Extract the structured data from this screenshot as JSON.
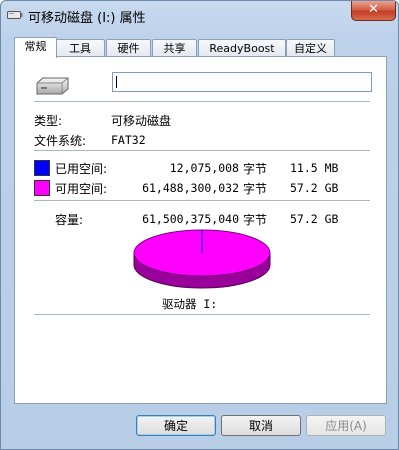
{
  "window": {
    "title": "可移动磁盘 (I:) 属性",
    "close_glyph": "✕"
  },
  "tabs": [
    {
      "label": "常规",
      "active": true
    },
    {
      "label": "工具",
      "active": false
    },
    {
      "label": "硬件",
      "active": false
    },
    {
      "label": "共享",
      "active": false
    },
    {
      "label": "ReadyBoost",
      "active": false
    },
    {
      "label": "自定义",
      "active": false
    }
  ],
  "general": {
    "volume_label_value": "",
    "type_label": "类型:",
    "type_value": "可移动磁盘",
    "fs_label": "文件系统:",
    "fs_value": "FAT32",
    "used": {
      "label": "已用空间:",
      "bytes": "12,075,008",
      "unit": "字节",
      "size": "11.5 MB",
      "color": "#0000ff"
    },
    "free": {
      "label": "可用空间:",
      "bytes": "61,488,300,032",
      "unit": "字节",
      "size": "57.2 GB",
      "color": "#ff00ff"
    },
    "capacity": {
      "label": "容量:",
      "bytes": "61,500,375,040",
      "unit": "字节",
      "size": "57.2 GB"
    },
    "used_fraction": 0.0002,
    "drive_caption": "驱动器 I:"
  },
  "buttons": {
    "ok": "确定",
    "cancel": "取消",
    "apply": "应用(A)"
  }
}
